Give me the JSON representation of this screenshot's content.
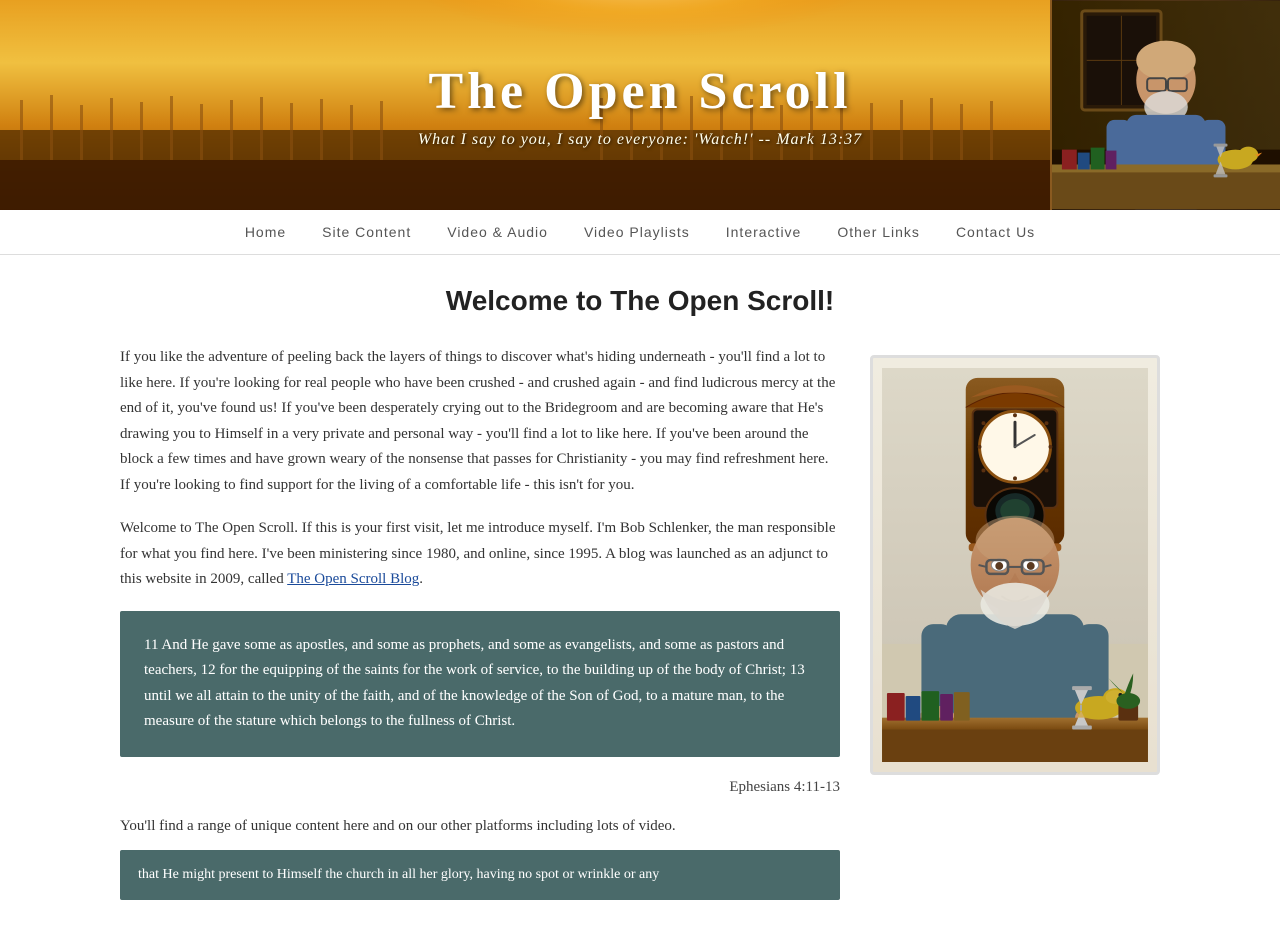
{
  "header": {
    "title": "The Open Scroll",
    "subtitle": "What I say to you, I say to everyone: 'Watch!' -- Mark 13:37"
  },
  "nav": {
    "items": [
      {
        "label": "Home",
        "id": "home"
      },
      {
        "label": "Site Content",
        "id": "site-content"
      },
      {
        "label": "Video & Audio",
        "id": "video-audio"
      },
      {
        "label": "Video Playlists",
        "id": "video-playlists"
      },
      {
        "label": "Interactive",
        "id": "interactive"
      },
      {
        "label": "Other Links",
        "id": "other-links"
      },
      {
        "label": "Contact Us",
        "id": "contact-us"
      }
    ]
  },
  "main": {
    "page_title": "Welcome to The Open Scroll!",
    "para1": "If you like the adventure of peeling back the layers of things to discover what's hiding underneath - you'll find a lot to like here. If you're looking for real people who have been crushed - and crushed again - and find ludicrous mercy at the end of it, you've found us! If you've been desperately crying out to the Bridegroom and are becoming aware that He's drawing you to Himself in a very private and personal way - you'll find a lot to like here. If you've been around the block a few times and have grown weary of the nonsense that passes for Christianity - you may find refreshment here. If you're looking to find support for the living of a comfortable life - this isn't for you.",
    "para2_part1": "Welcome to The Open Scroll. If this is your first visit, let me introduce myself. I'm Bob Schlenker, the man responsible for what you find here. I've been ministering since 1980, and online, since 1995. A blog was launched as an adjunct to this website in 2009, called ",
    "para2_link": "The Open Scroll Blog",
    "para2_part2": ".",
    "bible_quote": "11 And He gave some as apostles, and some as prophets, and some as evangelists, and some as pastors and teachers, 12 for the equipping of the saints for the work of service, to the building up of the body of Christ; 13 until we all attain to the unity of the faith, and of the knowledge of the Son of God, to a mature man, to the measure of the stature which belongs to the fullness of Christ.",
    "bible_citation": "Ephesians 4:11-13",
    "para3": "You'll find a range of unique content here and on our other platforms including lots of video.",
    "quote2": "that He might present to Himself the church in all her glory, having no spot or wrinkle or any"
  }
}
